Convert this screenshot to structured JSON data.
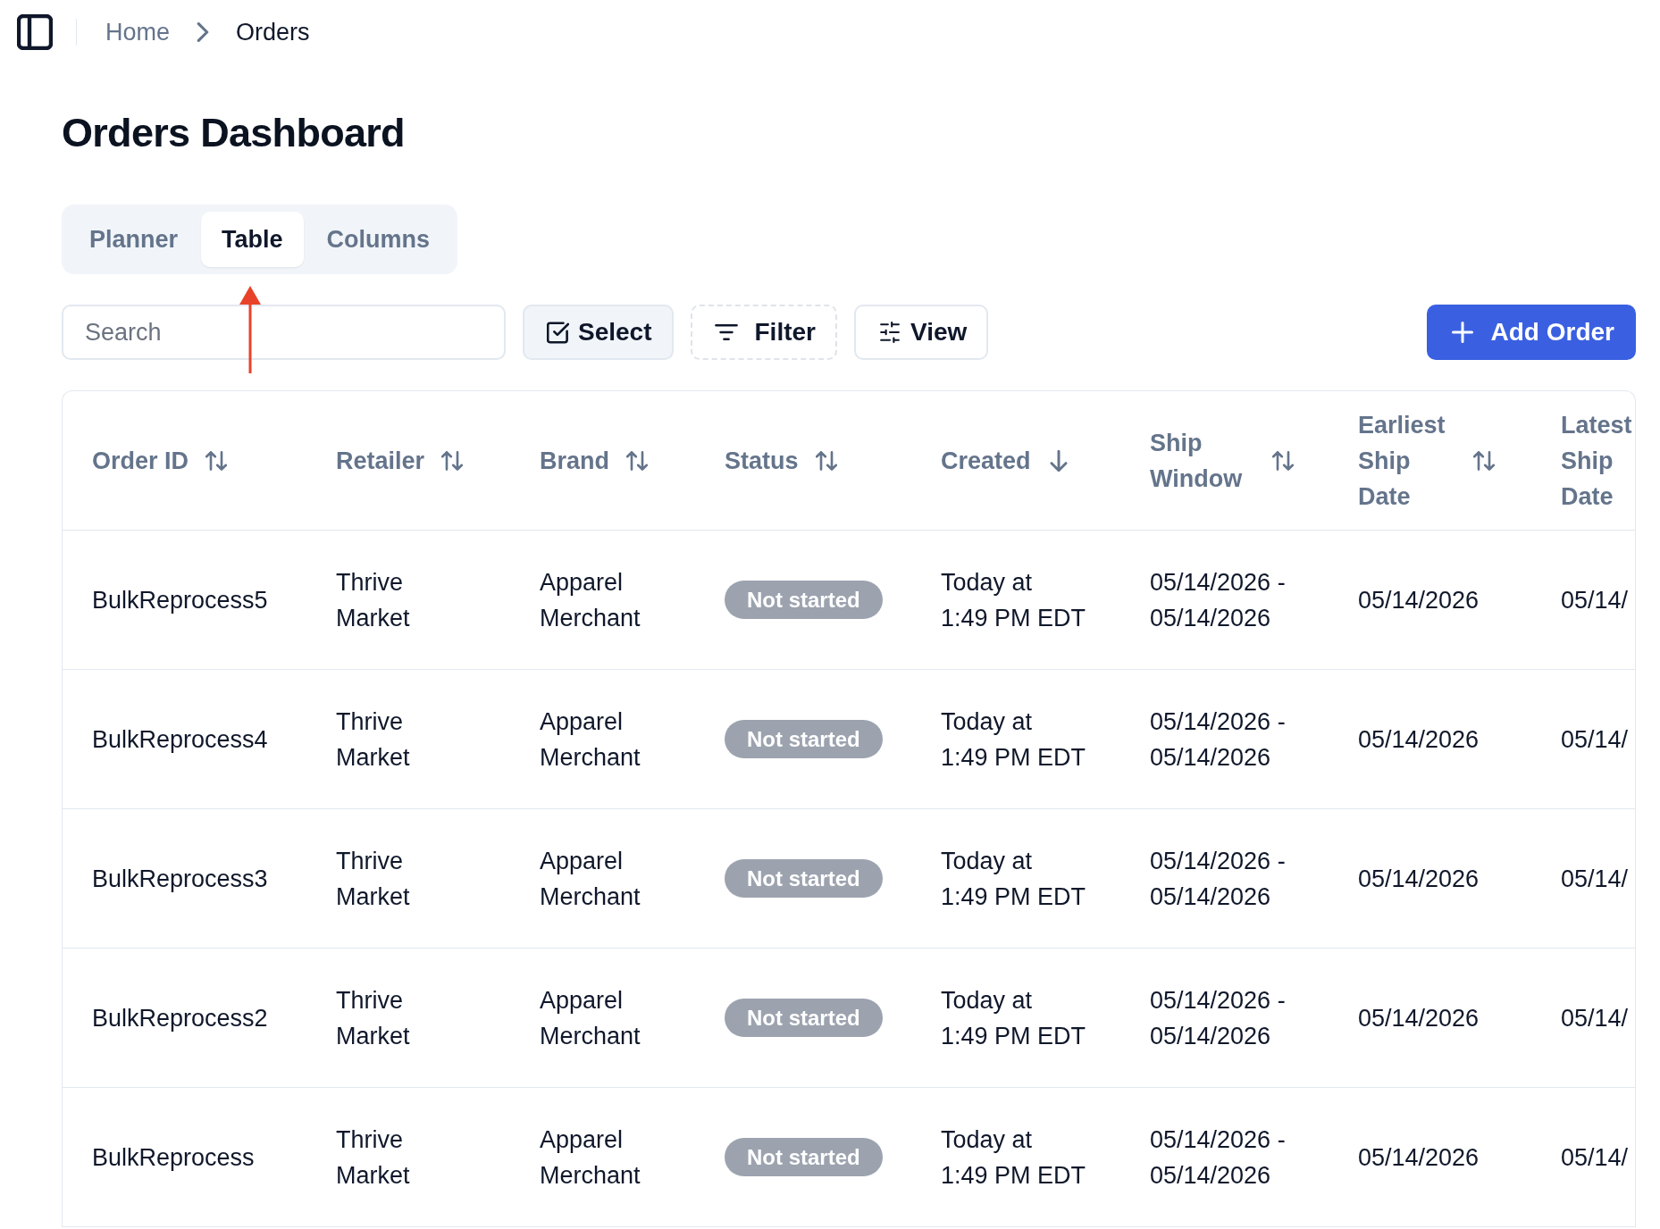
{
  "breadcrumb": {
    "items": [
      {
        "label": "Home",
        "current": false
      },
      {
        "label": "Orders",
        "current": true
      }
    ]
  },
  "title": "Orders Dashboard",
  "tabs": [
    {
      "label": "Planner",
      "selected": false
    },
    {
      "label": "Table",
      "selected": true
    },
    {
      "label": "Columns",
      "selected": false
    }
  ],
  "annotation": {
    "kind": "arrow"
  },
  "toolbar": {
    "search": {
      "placeholder": "Search"
    },
    "buttons": [
      {
        "label": "Select",
        "kind": "select"
      },
      {
        "label": "Filter",
        "kind": "filter"
      },
      {
        "label": "View",
        "kind": "view"
      }
    ],
    "primary_button": {
      "label": "Add Order"
    }
  },
  "table": {
    "columns": [
      {
        "label": "Order ID",
        "sorted": false
      },
      {
        "label": "Retailer",
        "sorted": false
      },
      {
        "label": "Brand",
        "sorted": false
      },
      {
        "label": "Status",
        "sorted": false
      },
      {
        "label": "Created",
        "sorted": true
      },
      {
        "label": "Ship Window",
        "sorted": false
      },
      {
        "label": "Earliest Ship Date",
        "sorted": false
      },
      {
        "label": "Latest Ship Date"
      }
    ],
    "rows": [
      {
        "order_id": "BulkReprocess5",
        "retailer": "Thrive Market",
        "brand": "Apparel Merchant",
        "status": "Not started",
        "created": "Today at 1:49 PM EDT",
        "ship_window": "05/14/2026 - 05/14/2026",
        "earliest_ship_date": "05/14/2026",
        "latest_ship_date": "05/14/"
      },
      {
        "order_id": "BulkReprocess4",
        "retailer": "Thrive Market",
        "brand": "Apparel Merchant",
        "status": "Not started",
        "created": "Today at 1:49 PM EDT",
        "ship_window": "05/14/2026 - 05/14/2026",
        "earliest_ship_date": "05/14/2026",
        "latest_ship_date": "05/14/"
      },
      {
        "order_id": "BulkReprocess3",
        "retailer": "Thrive Market",
        "brand": "Apparel Merchant",
        "status": "Not started",
        "created": "Today at 1:49 PM EDT",
        "ship_window": "05/14/2026 - 05/14/2026",
        "earliest_ship_date": "05/14/2026",
        "latest_ship_date": "05/14/"
      },
      {
        "order_id": "BulkReprocess2",
        "retailer": "Thrive Market",
        "brand": "Apparel Merchant",
        "status": "Not started",
        "created": "Today at 1:49 PM EDT",
        "ship_window": "05/14/2026 - 05/14/2026",
        "earliest_ship_date": "05/14/2026",
        "latest_ship_date": "05/14/"
      },
      {
        "order_id": "BulkReprocess",
        "retailer": "Thrive Market",
        "brand": "Apparel Merchant",
        "status": "Not started",
        "created": "Today at 1:49 PM EDT",
        "ship_window": "05/14/2026 - 05/14/2026",
        "earliest_ship_date": "05/14/2026",
        "latest_ship_date": "05/14/"
      }
    ]
  }
}
